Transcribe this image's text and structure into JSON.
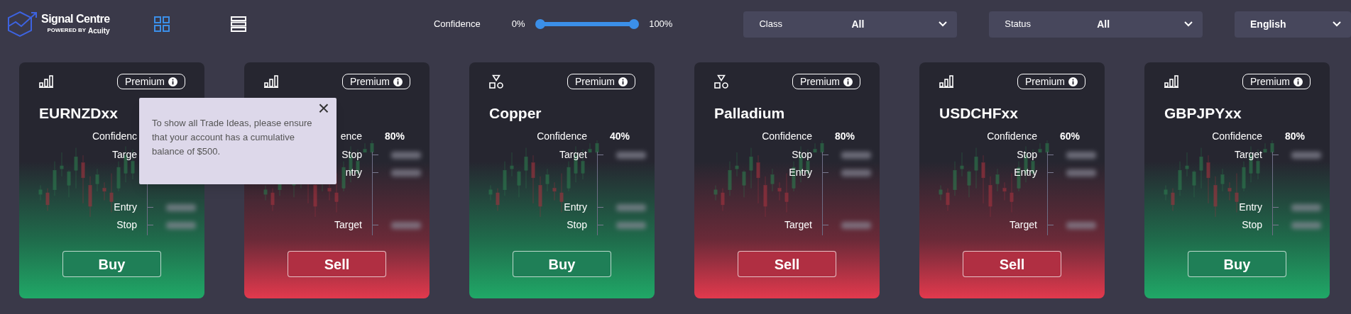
{
  "header": {
    "logo": {
      "title": "Signal Centre",
      "powered_by": "POWERED BY",
      "brand": "Acuity"
    },
    "views": [
      {
        "kind": "grid",
        "selected": true
      },
      {
        "kind": "list",
        "selected": false
      }
    ],
    "confidence_filter": {
      "label": "Confidence",
      "min_label": "0%",
      "max_label": "100%",
      "thumbs": [
        {
          "level": 0
        },
        {
          "level": 1
        }
      ]
    },
    "dropdowns": [
      {
        "label": "Class",
        "value": "All"
      },
      {
        "label": "Status",
        "value": "All"
      },
      {
        "value": "English"
      }
    ]
  },
  "cards": [
    {
      "kind": "buy",
      "icon": {
        "kind": "bars"
      },
      "badge": "Premium",
      "name": "EURNZDxx",
      "confidence_label": "Confidenc",
      "button": "Buy",
      "levels": [
        {
          "label": "Targe",
          "kind": "upper"
        },
        {
          "label": "Entry",
          "kind": "lower"
        },
        {
          "label": "Stop",
          "kind": "lower"
        }
      ]
    },
    {
      "kind": "sell",
      "icon": {
        "kind": "bars"
      },
      "badge": "Premium",
      "confidence_label": "ence",
      "confidence": "80%",
      "button": "Sell",
      "levels": [
        {
          "label": "Stop",
          "kind": "upper"
        },
        {
          "label": "ntry",
          "kind": "upper"
        },
        {
          "label": "Target",
          "kind": "lower"
        }
      ]
    },
    {
      "kind": "buy",
      "icon": {
        "kind": "shapes"
      },
      "badge": "Premium",
      "name": "Copper",
      "confidence_label": "Confidence",
      "confidence": "40%",
      "button": "Buy",
      "levels": [
        {
          "label": "Target",
          "kind": "upper"
        },
        {
          "label": "Entry",
          "kind": "lower"
        },
        {
          "label": "Stop",
          "kind": "lower"
        }
      ]
    },
    {
      "kind": "sell",
      "icon": {
        "kind": "shapes"
      },
      "badge": "Premium",
      "name": "Palladium",
      "confidence_label": "Confidence",
      "confidence": "80%",
      "button": "Sell",
      "levels": [
        {
          "label": "Stop",
          "kind": "upper"
        },
        {
          "label": "Entry",
          "kind": "upper"
        },
        {
          "label": "Target",
          "kind": "lower"
        }
      ]
    },
    {
      "kind": "sell",
      "icon": {
        "kind": "bars"
      },
      "badge": "Premium",
      "name": "USDCHFxx",
      "confidence_label": "Confidence",
      "confidence": "60%",
      "button": "Sell",
      "levels": [
        {
          "label": "Stop",
          "kind": "upper"
        },
        {
          "label": "Entry",
          "kind": "upper"
        },
        {
          "label": "Target",
          "kind": "lower"
        }
      ]
    },
    {
      "kind": "buy",
      "icon": {
        "kind": "bars"
      },
      "badge": "Premium",
      "name": "GBPJPYxx",
      "confidence_label": "Confidence",
      "confidence": "80%",
      "button": "Buy",
      "levels": [
        {
          "label": "Target",
          "kind": "upper"
        },
        {
          "label": "Entry",
          "kind": "lower"
        },
        {
          "label": "Stop",
          "kind": "lower"
        }
      ]
    }
  ],
  "tooltip": {
    "text": "To show all Trade Ideas, please ensure that your account has a cumulative balance of $500.",
    "close": "×"
  }
}
